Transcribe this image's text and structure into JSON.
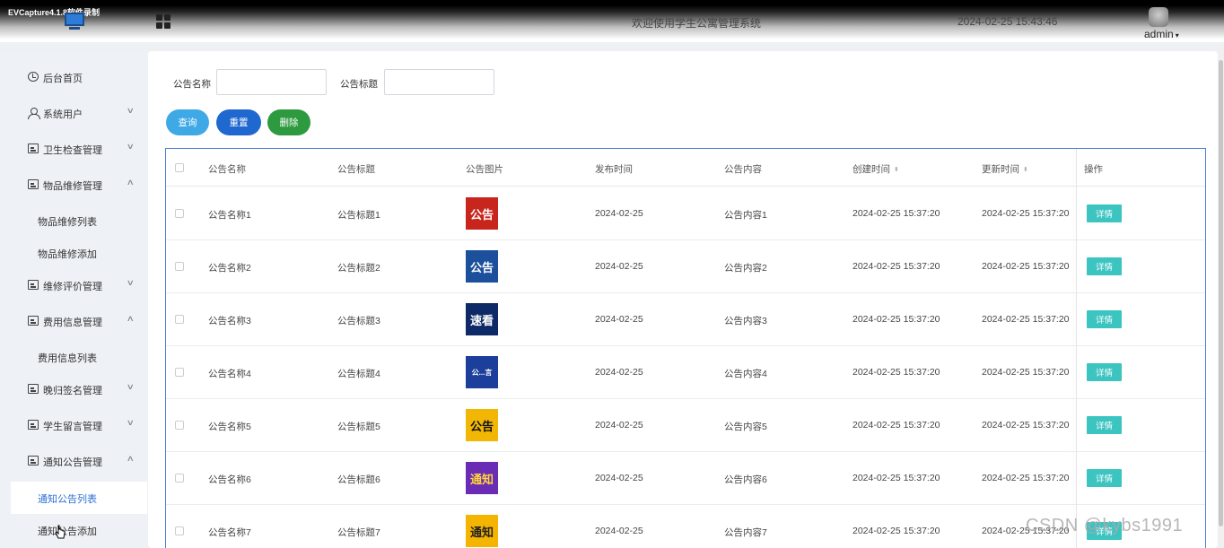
{
  "header": {
    "recorder_label": "EVCapture4.1.8软件录制",
    "welcome": "欢迎使用学生公寓管理系统",
    "datetime": "2024-02-25 15:43:46",
    "user": "admin",
    "user_caret": "▾"
  },
  "sidebar": {
    "items": [
      {
        "label": "后台首页",
        "icon": "clock-icon"
      },
      {
        "label": "系统用户",
        "icon": "user-icon",
        "chevron": "∨"
      },
      {
        "label": "卫生检查管理",
        "icon": "card-icon",
        "chevron": "∨"
      },
      {
        "label": "物品维修管理",
        "icon": "card-icon",
        "chevron": "∧"
      },
      {
        "label": "物品维修列表"
      },
      {
        "label": "物品维修添加"
      },
      {
        "label": "维修评价管理",
        "icon": "card-icon",
        "chevron": "∨"
      },
      {
        "label": "费用信息管理",
        "icon": "card-icon",
        "chevron": "∧"
      },
      {
        "label": "费用信息列表"
      },
      {
        "label": "晚归签名管理",
        "icon": "card-icon",
        "chevron": "∨"
      },
      {
        "label": "学生留言管理",
        "icon": "card-icon",
        "chevron": "∨"
      },
      {
        "label": "通知公告管理",
        "icon": "card-icon",
        "chevron": "∧"
      },
      {
        "label": "通知公告列表",
        "active": true
      },
      {
        "label": "通知公告添加"
      }
    ]
  },
  "search": {
    "name_label": "公告名称",
    "name_value": "",
    "title_label": "公告标题",
    "title_value": ""
  },
  "buttons": {
    "query": "查询",
    "reset": "重置",
    "delete": "删除"
  },
  "table": {
    "columns": [
      "公告名称",
      "公告标题",
      "公告图片",
      "发布时间",
      "公告内容",
      "创建时间",
      "更新时间",
      "操作"
    ],
    "sort_glyph": "⬍",
    "action_label": "详情",
    "rows": [
      {
        "name": "公告名称1",
        "title": "公告标题1",
        "img_text": "公告",
        "img_bg": "#c8261c",
        "img_fg": "#ffffff",
        "publish": "2024-02-25",
        "content": "公告内容1",
        "created": "2024-02-25 15:37:20",
        "updated": "2024-02-25 15:37:20"
      },
      {
        "name": "公告名称2",
        "title": "公告标题2",
        "img_text": "公告",
        "img_bg": "#1c4f9c",
        "img_fg": "#ffffff",
        "publish": "2024-02-25",
        "content": "公告内容2",
        "created": "2024-02-25 15:37:20",
        "updated": "2024-02-25 15:37:20"
      },
      {
        "name": "公告名称3",
        "title": "公告标题3",
        "img_text": "速看",
        "img_bg": "#0d2a66",
        "img_fg": "#ffffff",
        "publish": "2024-02-25",
        "content": "公告内容3",
        "created": "2024-02-25 15:37:20",
        "updated": "2024-02-25 15:37:20"
      },
      {
        "name": "公告名称4",
        "title": "公告标题4",
        "img_text": "公...言",
        "img_bg": "#1b3f9a",
        "img_fg": "#ffffff",
        "publish": "2024-02-25",
        "content": "公告内容4",
        "created": "2024-02-25 15:37:20",
        "updated": "2024-02-25 15:37:20"
      },
      {
        "name": "公告名称5",
        "title": "公告标题5",
        "img_text": "公告",
        "img_bg": "#f2b705",
        "img_fg": "#111111",
        "publish": "2024-02-25",
        "content": "公告内容5",
        "created": "2024-02-25 15:37:20",
        "updated": "2024-02-25 15:37:20"
      },
      {
        "name": "公告名称6",
        "title": "公告标题6",
        "img_text": "通知",
        "img_bg": "#6a2bb5",
        "img_fg": "#ffd43b",
        "publish": "2024-02-25",
        "content": "公告内容6",
        "created": "2024-02-25 15:37:20",
        "updated": "2024-02-25 15:37:20"
      },
      {
        "name": "公告名称7",
        "title": "公告标题7",
        "img_text": "通知",
        "img_bg": "#f4b400",
        "img_fg": "#222222",
        "publish": "2024-02-25",
        "content": "公告内容7",
        "created": "2024-02-25 15:37:20",
        "updated": "2024-02-25 15:37:20"
      }
    ]
  },
  "watermark": "CSDN @kybs1991",
  "colors": {
    "query": "#3fa9e6",
    "reset": "#1f68cf",
    "delete": "#2e9a3f",
    "detail": "#3cc4c1",
    "active_link": "#2f6fd6"
  }
}
